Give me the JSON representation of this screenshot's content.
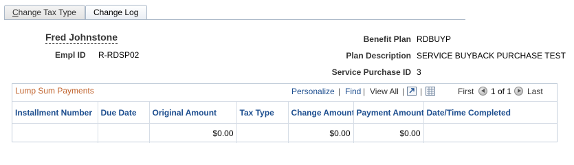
{
  "tabs": {
    "change_tax_type_prefix": "C",
    "change_tax_type_rest": "hange Tax Type",
    "change_log": "Change Log"
  },
  "employee": {
    "name": "Fred Johnstone",
    "empl_id_label": "Empl ID",
    "empl_id_value": "R-RDSP02",
    "benefit_plan_label": "Benefit Plan",
    "benefit_plan_value": "RDBUYP",
    "plan_description_label": "Plan Description",
    "plan_description_value": "SERVICE BUYBACK PURCHASE TEST",
    "service_purchase_id_label": "Service Purchase ID",
    "service_purchase_id_value": "3"
  },
  "grid": {
    "title": "Lump Sum Payments",
    "personalize": "Personalize",
    "find": "Find",
    "view_all": "View All",
    "first": "First",
    "range": "1 of 1",
    "last": "Last",
    "columns": [
      "Installment Number",
      "Due Date",
      "Original Amount",
      "Tax Type",
      "Change Amount",
      "Payment Amount",
      "Date/Time Completed"
    ],
    "rows": [
      {
        "installment_number": "",
        "due_date": "",
        "original_amount": "$0.00",
        "tax_type": "",
        "change_amount": "$0.00",
        "payment_amount": "$0.00",
        "date_time_completed": ""
      }
    ]
  }
}
